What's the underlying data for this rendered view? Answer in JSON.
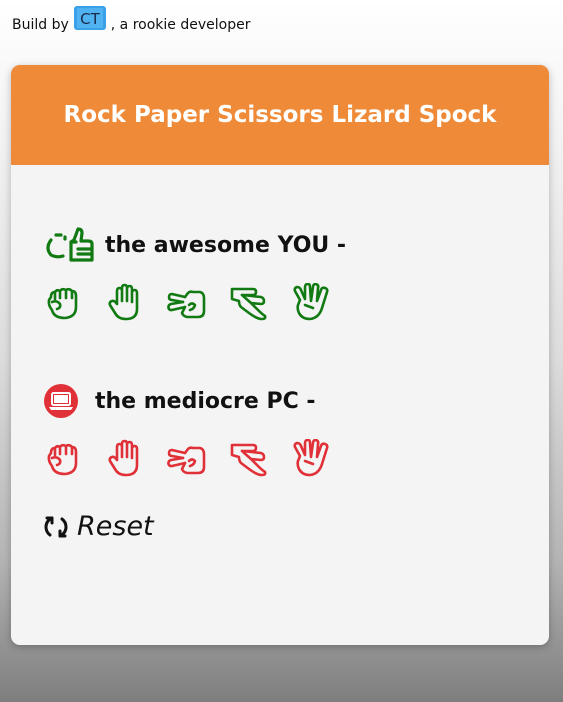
{
  "credit": {
    "prefix": "Build by",
    "logo_text": "CT",
    "suffix": ", a rookie developer"
  },
  "app": {
    "title": "Rock Paper Scissors Lizard Spock"
  },
  "player": {
    "icon": "thumbs-up-smile-icon",
    "label": "the awesome YOU -",
    "color": "#127a12",
    "choices": [
      "rock",
      "paper",
      "scissors",
      "lizard",
      "spock"
    ]
  },
  "pc": {
    "icon": "laptop-icon",
    "label": "the mediocre PC -",
    "color": "#e03038",
    "choices": [
      "rock",
      "paper",
      "scissors",
      "lizard",
      "spock"
    ]
  },
  "reset": {
    "label": "Reset",
    "icon": "refresh-icon"
  }
}
